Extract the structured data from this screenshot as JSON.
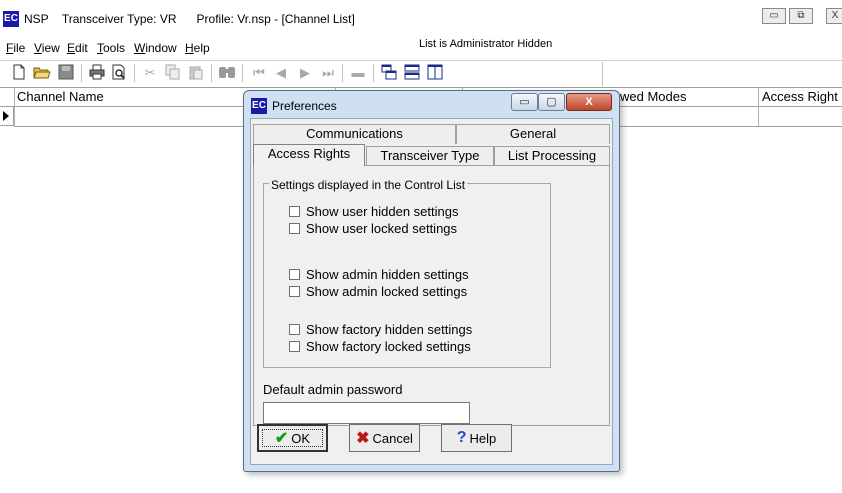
{
  "window": {
    "icon_glyph": "EC",
    "app": "NSP",
    "transceiver": "Transceiver Type: VR",
    "profile": "Profile: Vr.nsp - [Channel List]",
    "controls": {
      "minimize": "▭",
      "restore": "⧉",
      "close": "X"
    }
  },
  "menu": {
    "file": {
      "key": "F",
      "rest": "ile"
    },
    "view": {
      "key": "V",
      "rest": "iew"
    },
    "edit": {
      "key": "E",
      "rest": "dit"
    },
    "tools": {
      "key": "T",
      "rest": "ools"
    },
    "window": {
      "key": "W",
      "rest": "indow"
    },
    "help": {
      "key": "H",
      "rest": "elp"
    }
  },
  "status_note": "List is Administrator Hidden",
  "toolbar_icons": [
    "new-file-icon",
    "open-folder-icon",
    "save-icon",
    "print-icon",
    "print-preview-icon",
    "cut-icon",
    "copy-icon",
    "paste-icon",
    "binoculars-icon",
    "first-record-icon",
    "previous-record-icon",
    "next-record-icon",
    "last-record-icon",
    "delete-record-icon",
    "cascade-icon",
    "tile-horizontal-icon",
    "tile-vertical-icon"
  ],
  "grid": {
    "columns": {
      "channel_name": "Channel Name",
      "allowed_modes": "wed Modes",
      "access_rights": "Access Right"
    }
  },
  "dialog": {
    "icon_glyph": "EC",
    "title": "Preferences",
    "controls": {
      "minimize": "▭",
      "maximize": "▢",
      "close": "X"
    },
    "tabs": {
      "communications": "Communications",
      "general": "General",
      "access_rights": "Access Rights",
      "transceiver_type": "Transceiver Type",
      "list_processing": "List Processing"
    },
    "active_tab": "Access Rights",
    "group_title": "Settings displayed in the Control List",
    "options": {
      "user_hidden": {
        "label": "Show user hidden settings",
        "checked": false
      },
      "user_locked": {
        "label": "Show user locked settings",
        "checked": false
      },
      "admin_hidden": {
        "label": "Show admin hidden settings",
        "checked": false
      },
      "admin_locked": {
        "label": "Show admin locked settings",
        "checked": false
      },
      "factory_hidden": {
        "label": "Show factory hidden settings",
        "checked": false
      },
      "factory_locked": {
        "label": "Show factory locked settings",
        "checked": false
      }
    },
    "password": {
      "label": "Default admin password",
      "value": ""
    },
    "buttons": {
      "ok": {
        "icon": "✔",
        "label": "OK"
      },
      "cancel": {
        "icon": "✖",
        "label": "Cancel"
      },
      "help": {
        "icon": "?",
        "label": "Help"
      }
    }
  }
}
